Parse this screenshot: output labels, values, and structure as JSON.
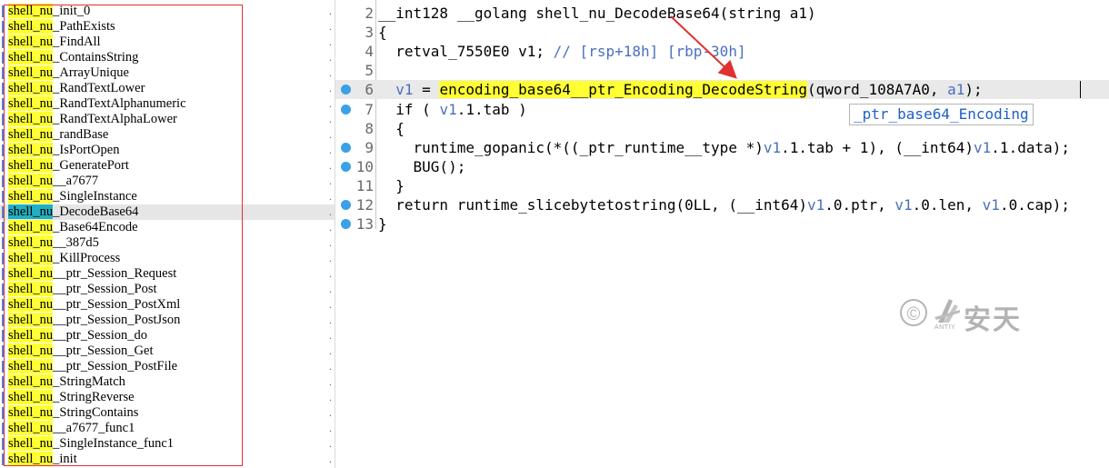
{
  "functions": [
    {
      "prefix": "shell_nu",
      "suffix": "_init_0"
    },
    {
      "prefix": "shell_nu",
      "suffix": "_PathExists"
    },
    {
      "prefix": "shell_nu",
      "suffix": "_FindAll"
    },
    {
      "prefix": "shell_nu",
      "suffix": "_ContainsString"
    },
    {
      "prefix": "shell_nu",
      "suffix": "_ArrayUnique"
    },
    {
      "prefix": "shell_nu",
      "suffix": "_RandTextLower"
    },
    {
      "prefix": "shell_nu",
      "suffix": "_RandTextAlphanumeric"
    },
    {
      "prefix": "shell_nu",
      "suffix": "_RandTextAlphaLower"
    },
    {
      "prefix": "shell_nu",
      "suffix": "_randBase"
    },
    {
      "prefix": "shell_nu",
      "suffix": "_IsPortOpen"
    },
    {
      "prefix": "shell_nu",
      "suffix": "_GeneratePort"
    },
    {
      "prefix": "shell_nu",
      "suffix": "__a7677"
    },
    {
      "prefix": "shell_nu",
      "suffix": "_SingleInstance"
    },
    {
      "prefix": "shell_nu",
      "suffix": "_DecodeBase64",
      "selected": true
    },
    {
      "prefix": "shell_nu",
      "suffix": "_Base64Encode"
    },
    {
      "prefix": "shell_nu",
      "suffix": "__387d5"
    },
    {
      "prefix": "shell_nu",
      "suffix": "_KillProcess"
    },
    {
      "prefix": "shell_nu",
      "suffix": "__ptr_Session_Request"
    },
    {
      "prefix": "shell_nu",
      "suffix": "__ptr_Session_Post"
    },
    {
      "prefix": "shell_nu",
      "suffix": "__ptr_Session_PostXml"
    },
    {
      "prefix": "shell_nu",
      "suffix": "__ptr_Session_PostJson"
    },
    {
      "prefix": "shell_nu",
      "suffix": "__ptr_Session_do"
    },
    {
      "prefix": "shell_nu",
      "suffix": "__ptr_Session_Get"
    },
    {
      "prefix": "shell_nu",
      "suffix": "__ptr_Session_PostFile"
    },
    {
      "prefix": "shell_nu",
      "suffix": "_StringMatch"
    },
    {
      "prefix": "shell_nu",
      "suffix": "_StringReverse"
    },
    {
      "prefix": "shell_nu",
      "suffix": "_StringContains"
    },
    {
      "prefix": "shell_nu",
      "suffix": "__a7677_func1"
    },
    {
      "prefix": "shell_nu",
      "suffix": "_SingleInstance_func1"
    },
    {
      "prefix": "shell_nu",
      "suffix": "_init"
    }
  ],
  "code": {
    "lines": [
      {
        "num": "2",
        "bp": false,
        "current": false,
        "segments": [
          {
            "t": "__int128 __golang shell_nu_DecodeBase64(string a1)"
          }
        ]
      },
      {
        "num": "3",
        "bp": false,
        "current": false,
        "segments": [
          {
            "t": "{"
          }
        ]
      },
      {
        "num": "4",
        "bp": false,
        "current": false,
        "segments": [
          {
            "t": "  retval_7550E0 v1; "
          },
          {
            "t": "// [rsp+18h] [rbp-30h]",
            "c": "cmt"
          }
        ]
      },
      {
        "num": "5",
        "bp": false,
        "current": false,
        "segments": [
          {
            "t": ""
          }
        ]
      },
      {
        "num": "6",
        "bp": true,
        "current": true,
        "segments": [
          {
            "t": "  "
          },
          {
            "t": "v1",
            "c": "var"
          },
          {
            "t": " = "
          },
          {
            "t": "encoding_base64__ptr_Encoding_DecodeString",
            "c": "hl"
          },
          {
            "t": "(qword_108A7A0, "
          },
          {
            "t": "a1",
            "c": "var"
          },
          {
            "t": ");"
          }
        ]
      },
      {
        "num": "7",
        "bp": true,
        "current": false,
        "segments": [
          {
            "t": "  if ( "
          },
          {
            "t": "v1",
            "c": "var"
          },
          {
            "t": ".1.tab )"
          }
        ]
      },
      {
        "num": "8",
        "bp": false,
        "current": false,
        "segments": [
          {
            "t": "  {"
          }
        ]
      },
      {
        "num": "9",
        "bp": true,
        "current": false,
        "segments": [
          {
            "t": "    runtime_gopanic(*((_ptr_runtime__type *)"
          },
          {
            "t": "v1",
            "c": "var"
          },
          {
            "t": ".1.tab + 1), (__int64)"
          },
          {
            "t": "v1",
            "c": "var"
          },
          {
            "t": ".1.data);"
          }
        ]
      },
      {
        "num": "10",
        "bp": true,
        "current": false,
        "segments": [
          {
            "t": "    BUG();"
          }
        ]
      },
      {
        "num": "11",
        "bp": false,
        "current": false,
        "segments": [
          {
            "t": "  }"
          }
        ]
      },
      {
        "num": "12",
        "bp": true,
        "current": false,
        "segments": [
          {
            "t": "  return runtime_slicebytetostring(0LL, (__int64)"
          },
          {
            "t": "v1",
            "c": "var"
          },
          {
            "t": ".0.ptr, "
          },
          {
            "t": "v1",
            "c": "var"
          },
          {
            "t": ".0.len, "
          },
          {
            "t": "v1",
            "c": "var"
          },
          {
            "t": ".0.cap);"
          }
        ]
      },
      {
        "num": "13",
        "bp": true,
        "current": false,
        "segments": [
          {
            "t": "}"
          }
        ]
      }
    ],
    "tooltip": "_ptr_base64_Encoding"
  },
  "watermark": {
    "copyright_symbol": "©",
    "logo_text": "ANTIY",
    "chinese_text": "安天"
  },
  "colors": {
    "highlight": "#ffff33",
    "selected_prefix": "#20b0c0",
    "breakpoint": "#3aa0e8",
    "annotation_red": "#e03030",
    "variable": "#4a6fc0"
  }
}
